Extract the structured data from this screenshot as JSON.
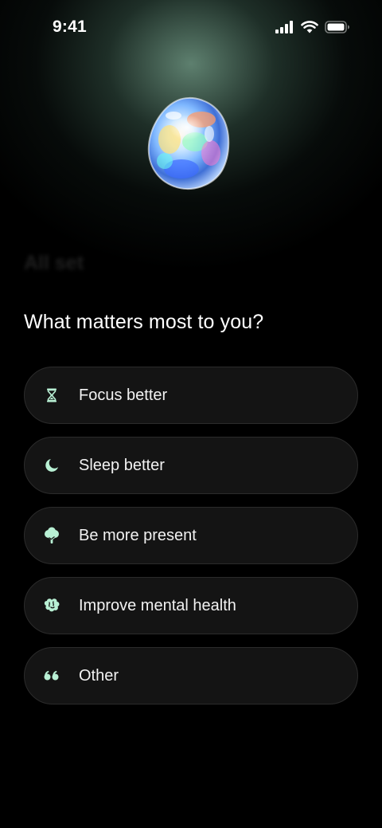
{
  "status_bar": {
    "time": "9:41",
    "signal_icon": "cellular-signal-icon",
    "wifi_icon": "wifi-icon",
    "battery_icon": "battery-icon"
  },
  "hero": {
    "image": "opal-gem-image"
  },
  "ghost_title": "All set",
  "question": "What matters most to you?",
  "accent_color": "#b8f0d4",
  "options": [
    {
      "label": "Focus better",
      "icon": "hourglass-icon"
    },
    {
      "label": "Sleep better",
      "icon": "moon-icon"
    },
    {
      "label": "Be more present",
      "icon": "tree-icon"
    },
    {
      "label": "Improve mental health",
      "icon": "brain-icon"
    },
    {
      "label": "Other",
      "icon": "quote-icon"
    }
  ]
}
